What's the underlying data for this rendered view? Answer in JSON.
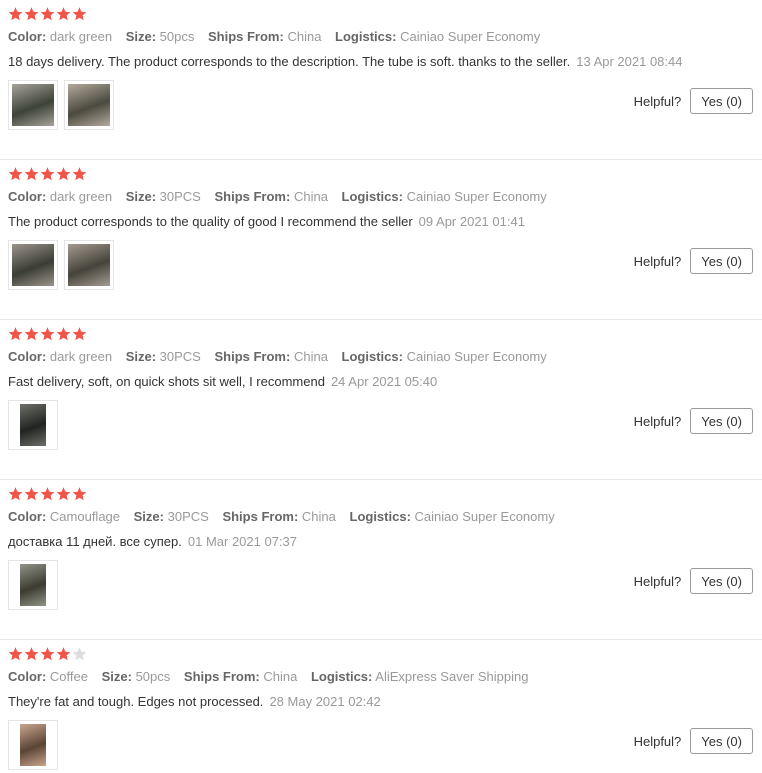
{
  "colors": {
    "star_full": "#f2534b",
    "star_empty": "#dddddd"
  },
  "helpful_label": "Helpful?",
  "reviews": [
    {
      "rating": 5,
      "color_label": "Color:",
      "color": "dark green",
      "size_label": "Size:",
      "size": "50pcs",
      "ships_label": "Ships From:",
      "ships": "China",
      "logistics_label": "Logistics:",
      "logistics": "Cainiao Super Economy",
      "text": "18 days delivery. The product corresponds to the description. The tube is soft. thanks to the seller.",
      "date": "13 Apr 2021 08:44",
      "yes_label": "Yes (0)",
      "photos": [
        {
          "icon": "review-photo-icon",
          "tone": [
            "#a7a39b",
            "#3d4338"
          ]
        },
        {
          "icon": "review-photo-icon",
          "tone": [
            "#b4ab9e",
            "#4b4a3e"
          ]
        }
      ]
    },
    {
      "rating": 5,
      "color_label": "Color:",
      "color": "dark green",
      "size_label": "Size:",
      "size": "30PCS",
      "ships_label": "Ships From:",
      "ships": "China",
      "logistics_label": "Logistics:",
      "logistics": "Cainiao Super Economy",
      "text": "The product corresponds to the quality of good I recommend the seller",
      "date": "09 Apr 2021 01:41",
      "yes_label": "Yes (0)",
      "photos": [
        {
          "icon": "review-photo-icon",
          "tone": [
            "#9c948c",
            "#3a3d35"
          ]
        },
        {
          "icon": "review-photo-icon",
          "tone": [
            "#a59b92",
            "#45443a"
          ]
        }
      ]
    },
    {
      "rating": 5,
      "color_label": "Color:",
      "color": "dark green",
      "size_label": "Size:",
      "size": "30PCS",
      "ships_label": "Ships From:",
      "ships": "China",
      "logistics_label": "Logistics:",
      "logistics": "Cainiao Super Economy",
      "text": "Fast delivery, soft, on quick shots sit well, I recommend",
      "date": "24 Apr 2021 05:40",
      "yes_label": "Yes (0)",
      "photos": [
        {
          "icon": "review-photo-icon",
          "tone": [
            "#6d6f6a",
            "#222421"
          ],
          "narrow": true
        }
      ]
    },
    {
      "rating": 5,
      "color_label": "Color:",
      "color": "Camouflage",
      "size_label": "Size:",
      "size": "30PCS",
      "ships_label": "Ships From:",
      "ships": "China",
      "logistics_label": "Logistics:",
      "logistics": "Cainiao Super Economy",
      "text": "доставка 11 дней. все супер.",
      "date": "01 Mar 2021 07:37",
      "yes_label": "Yes (0)",
      "photos": [
        {
          "icon": "review-photo-icon",
          "tone": [
            "#8f9588",
            "#3e3b30"
          ],
          "narrow": true
        }
      ]
    },
    {
      "rating": 4,
      "color_label": "Color:",
      "color": "Coffee",
      "size_label": "Size:",
      "size": "50pcs",
      "ships_label": "Ships From:",
      "ships": "China",
      "logistics_label": "Logistics:",
      "logistics": "AliExpress Saver Shipping",
      "text": "They're fat and tough. Edges not processed.",
      "date": "28 May 2021 02:42",
      "yes_label": "Yes (0)",
      "photos": [
        {
          "icon": "review-photo-icon",
          "tone": [
            "#c9a58e",
            "#5a4535"
          ],
          "narrow": true
        }
      ]
    }
  ]
}
